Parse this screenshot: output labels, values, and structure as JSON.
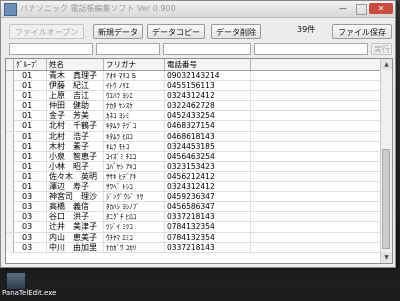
{
  "window": {
    "title": "パナソニック 電話帳編集ソフト  Ver 0.900"
  },
  "toolbar": {
    "open_label": "ファイルオープン",
    "new_label": "新規データ",
    "copy_label": "データコピー",
    "delete_label": "データ削除",
    "count_label": "39件",
    "save_label": "ファイル保存"
  },
  "search": {
    "run_label": "実行"
  },
  "table": {
    "columns": [
      "ｸﾞﾙｰﾌﾟ",
      "姓名",
      "フリガナ",
      "電話番号"
    ],
    "rows": [
      {
        "group": "01",
        "name": "青木　真理子",
        "kana": "ｱｵｷ ﾏﾘｺ S",
        "tel": "09032143214"
      },
      {
        "group": "01",
        "name": "伊藤　紀江",
        "kana": "ｲﾄｳ ﾉﾘｴ",
        "tel": "0455156113"
      },
      {
        "group": "01",
        "name": "上原　吉江",
        "kana": "ｳｴﾊﾗ ﾖｼｴ",
        "tel": "0324312412"
      },
      {
        "group": "01",
        "name": "仲田　健助",
        "kana": "ﾅｶﾀ ｹﾝｽｹ",
        "tel": "0322462728"
      },
      {
        "group": "01",
        "name": "金子　芳美",
        "kana": "ｶﾈｺ ﾖｼﾐ",
        "tel": "0452433254"
      },
      {
        "group": "01",
        "name": "北村　千鶴子",
        "kana": "ｷﾀﾑﾗ ﾁﾂﾞｺ",
        "tel": "0468327154"
      },
      {
        "group": "01",
        "name": "北村　浩子",
        "kana": "ｷﾀﾑﾗ ﾋﾛｺ",
        "tel": "0468618143"
      },
      {
        "group": "01",
        "name": "木村　素子",
        "kana": "ｷﾑﾗ ﾓﾄｺ",
        "tel": "0324453185"
      },
      {
        "group": "01",
        "name": "小泉　智恵子",
        "kana": "ｺｲｽﾞﾐ ﾁｴｺ",
        "tel": "0456463254"
      },
      {
        "group": "01",
        "name": "小林　昭子",
        "kana": "ｺﾊﾞﾔｼ ｱｷｺ",
        "tel": "0323153423"
      },
      {
        "group": "01",
        "name": "佐々木　英明",
        "kana": "ｻｻｷ ﾋﾃﾞｱｷ",
        "tel": "0456212412"
      },
      {
        "group": "01",
        "name": "澤辺　寿子",
        "kana": "ｻﾜﾍﾞ ﾄｼｺ",
        "tel": "0324312412"
      },
      {
        "group": "03",
        "name": "神宮司　理沙",
        "kana": "ｼﾞﾝｸﾞｳｼﾞ ﾘｻ",
        "tel": "0459236347"
      },
      {
        "group": "03",
        "name": "高橋　義信",
        "kana": "ﾀｶﾊｼ ﾖｼﾉﾌﾞ",
        "tel": "0456586347"
      },
      {
        "group": "03",
        "name": "谷口　洪子",
        "kana": "ﾀﾆｸﾞﾁ ﾋﾛｺ",
        "tel": "0337218143"
      },
      {
        "group": "03",
        "name": "辻井　美津子",
        "kana": "ﾂｼﾞｲ ﾐﾂｺ",
        "tel": "0784132354"
      },
      {
        "group": "03",
        "name": "内山　恵美子",
        "kana": "ｳﾁﾔﾏ ｴﾐｺ",
        "tel": "0784132354"
      },
      {
        "group": "03",
        "name": "中川　由加里",
        "kana": "ﾅｶｶﾞﾜ ﾕｶﾘ",
        "tel": "0337218143"
      }
    ]
  },
  "desktop": {
    "taskbar_label": "PanaTelEdit.exe"
  }
}
